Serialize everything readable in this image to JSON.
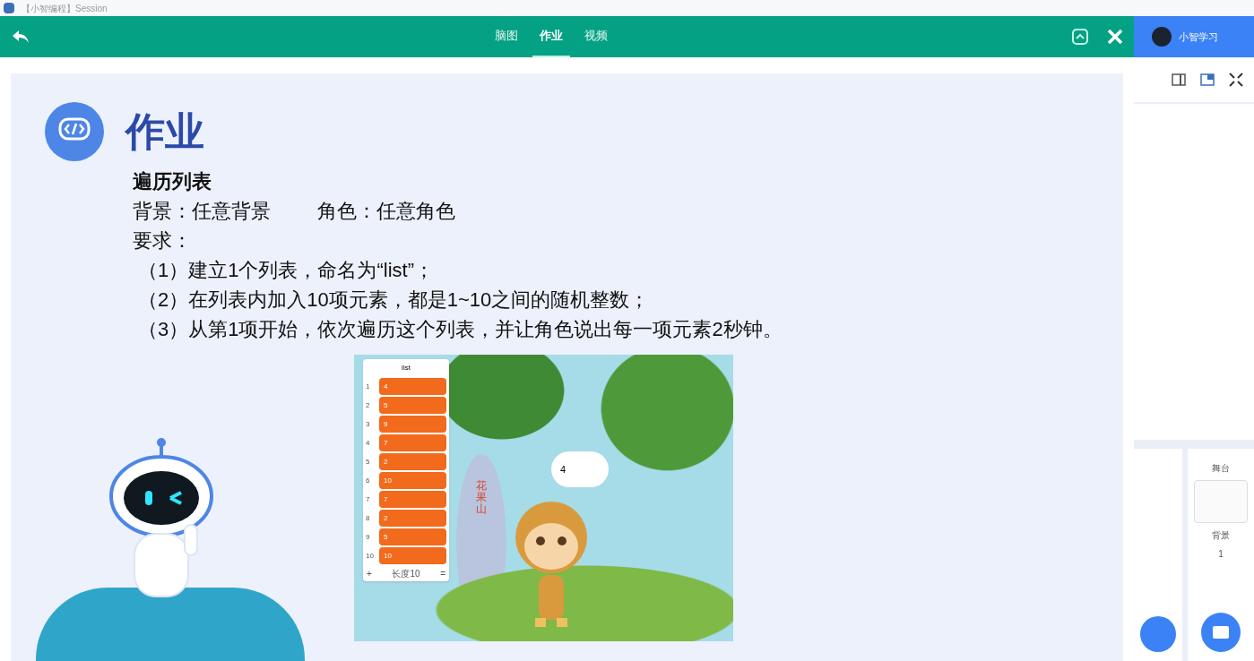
{
  "window": {
    "title": "【小智编程】Session"
  },
  "toolbar": {
    "tabs": [
      {
        "label": "脑图",
        "selected": false
      },
      {
        "label": "作业",
        "selected": true
      },
      {
        "label": "视频",
        "selected": false
      }
    ]
  },
  "slide": {
    "heading": "作业",
    "title": "遍历列表",
    "background_label": "背景：任意背景",
    "sprite_label": "角色：任意角色",
    "requirements_label": "要求：",
    "requirements": [
      "（1）建立1个列表，命名为“list”；",
      "（2）在列表内加入10项元素，都是1~10之间的随机整数；",
      "（3）从第1项开始，依次遍历这个列表，并让角色说出每一项元素2秒钟。"
    ],
    "stage": {
      "list_name": "list",
      "items": [
        {
          "index": "1",
          "value": "4"
        },
        {
          "index": "2",
          "value": "5"
        },
        {
          "index": "3",
          "value": "9"
        },
        {
          "index": "4",
          "value": "7"
        },
        {
          "index": "5",
          "value": "2"
        },
        {
          "index": "6",
          "value": "10"
        },
        {
          "index": "7",
          "value": "7"
        },
        {
          "index": "8",
          "value": "2"
        },
        {
          "index": "9",
          "value": "5"
        },
        {
          "index": "10",
          "value": "10"
        }
      ],
      "add_symbol": "+",
      "length_label": "长度10",
      "resize_symbol": "=",
      "speech": "4",
      "mountain_text": "花果山"
    }
  },
  "side_panel": {
    "user": "小智学习",
    "stage_label": "舞台",
    "backdrop_label": "背景",
    "backdrop_count": "1"
  }
}
